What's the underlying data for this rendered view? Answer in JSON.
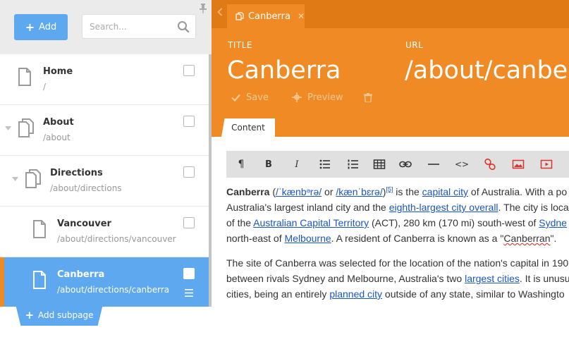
{
  "sidebar": {
    "add_button_label": "Add",
    "search_placeholder": "Search...",
    "add_subpage_label": "Add subpage",
    "pages": [
      {
        "title": "Home",
        "path": "/"
      },
      {
        "title": "About",
        "path": "/about"
      },
      {
        "title": "Directions",
        "path": "/about/directions"
      },
      {
        "title": "Vancouver",
        "path": "/about/directions/vancouver"
      },
      {
        "title": "Canberra",
        "path": "/about/directions/canberra"
      }
    ]
  },
  "editor": {
    "tab_title": "Canberra",
    "title_label": "TITLE",
    "title_value": "Canberra",
    "url_label": "URL",
    "url_value": "/about/canberra",
    "save_label": "Save",
    "preview_label": "Preview",
    "content_tab_label": "Content",
    "toolbar_icons": [
      "paragraph-icon",
      "bold-icon",
      "italic-icon",
      "bulleted-list-icon",
      "numbered-list-icon",
      "table-icon",
      "link-icon",
      "horizontal-rule-icon",
      "code-icon",
      "unlink-icon",
      "image-icon",
      "video-icon"
    ]
  },
  "article": {
    "p1": {
      "term": "Canberra",
      "open_paren": " (",
      "ipa1": "/ˈkænbᵊrə/",
      "or": " or ",
      "ipa2": "/kænˈbɛrə/",
      "close_paren": ")",
      "ref": "[5]",
      "t1": " is the ",
      "link_capital": "capital city",
      "t2": " of Australia. With a po",
      "t3": "Australia's largest inland city and the ",
      "link_eighth": "eighth-largest city overall",
      "t4": ". The city is loca",
      "t5": "of the ",
      "link_act": "Australian Capital Territory",
      "t6": " (ACT), 280 km (170 mi) south-west of ",
      "link_sydney": "Sydne",
      "t7": "north-east of ",
      "link_melbourne": "Melbourne",
      "t8": ". A resident of Canberra is known as a \"",
      "canberran": "Canberran",
      "t9": "\"."
    },
    "p2": {
      "t1": "The site of Canberra was selected for the location of the nation's capital in 190",
      "t2": "between rivals Sydney and Melbourne, Australia's two ",
      "link_largest": "largest cities",
      "t3": ". It is unusu",
      "t4": "cities, being an entirely ",
      "link_planned": "planned city",
      "t5": " outside of any state, similar to Washingto"
    }
  },
  "colors": {
    "accent_blue": "#5ea8f0",
    "accent_orange": "#f08a24",
    "tabbar_orange": "#e07a14",
    "link_blue": "#1a56c2",
    "toolbar_red": "#d9342b"
  }
}
